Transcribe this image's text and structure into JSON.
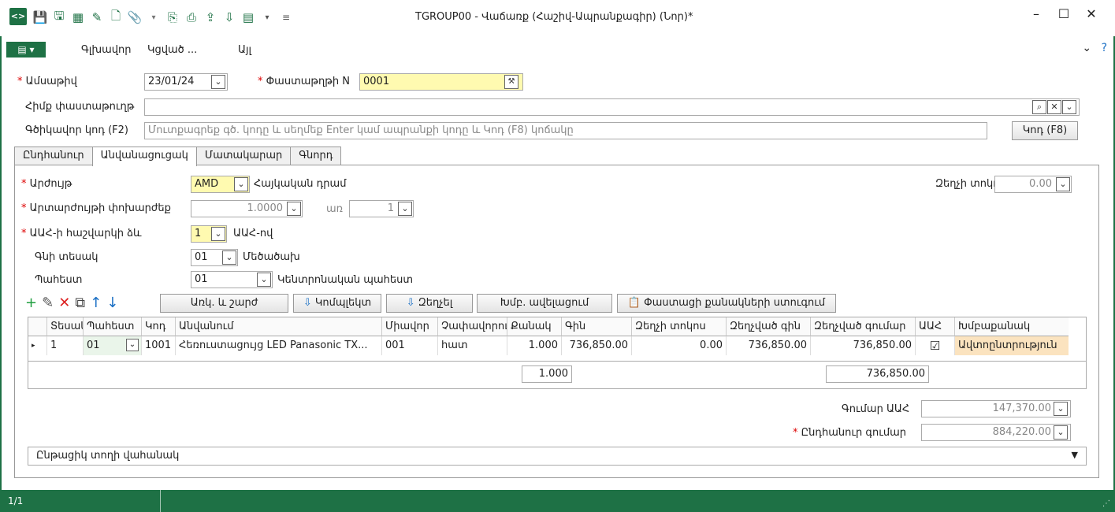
{
  "window": {
    "title": "TGROUP00 - Վաճառք (Հաշիվ-Ապրանքագիր) (Նոր)*",
    "logo": "ꟹ",
    "minimize": "–",
    "maximize": "☐",
    "close": "✕"
  },
  "qat": [
    "save-icon",
    "save-close-icon",
    "save-as-icon",
    "edit-icon",
    "new-doc-icon",
    "attach-icon",
    "dropdown-icon",
    "copy-icon",
    "print-icon",
    "export-icon",
    "import-icon",
    "table-icon",
    "more-icon"
  ],
  "menu": {
    "toggle": "▤ ▾",
    "items": [
      "Գլխավոր",
      "Կցված ...",
      "Այլ"
    ],
    "chevron": "⌄",
    "help": "?"
  },
  "form": {
    "date_label": "Ամսաթիվ",
    "date_value": "23/01/24",
    "docnum_label": "Փաստաթղթի N",
    "docnum_value": "0001",
    "basedoc_label": "Հիմք փաստաթուղթ",
    "basedoc_value": "",
    "barcode_label": "Գծիկավոր կոդ (F2)",
    "barcode_placeholder": "Մուտքագրեք գծ. կոդը և սեղմեք Enter կամ ապրանքի կոդը և Կոդ (F8) կոճակը",
    "code_button": "Կոդ (F8)"
  },
  "tabs": [
    "Ընդհանուր",
    "Անվանացուցակ",
    "Մատակարար",
    "Գնորդ"
  ],
  "panel": {
    "currency_label": "Արժույթ",
    "currency_value": "AMD",
    "currency_name": "Հայկական դրամ",
    "discount_label": "Զեղչի տոկոս",
    "discount_value": "0.00",
    "rate_label": "Արտարժույթի փոխարժեք",
    "rate_value": "1.0000",
    "per_label": "առ",
    "per_value": "1",
    "vat_label": "ԱԱՀ-ի հաշվարկի ձև",
    "vat_value": "1",
    "vat_name": "ԱԱՀ-ով",
    "price_type_label": "Գնի տեսակ",
    "price_type_value": "01",
    "price_type_name": "Մեծածախ",
    "warehouse_label": "Պահեստ",
    "warehouse_value": "01",
    "warehouse_name": "Կենտրոնական պահեստ"
  },
  "grid_toolbar": {
    "add": "+",
    "edit": "✎",
    "delete": "✕",
    "copy": "⧉",
    "up": "↑",
    "down": "↓",
    "b1": "Առկ. և շարժ",
    "b2": "Կոմպլեկտ",
    "b3": "Զեղչել",
    "b4": "Խմբ. ավելացում",
    "b5": "Փաստացի քանակների ստուգում"
  },
  "grid": {
    "headers": [
      "Տեսակ",
      "Պահեստ",
      "Կոդ",
      "Անվանում",
      "Միավոր",
      "Չափավորում",
      "Քանակ",
      "Գին",
      "Զեղչի տոկոս",
      "Զեղչված գին",
      "Զեղչված գումար",
      "ԱԱՀ",
      "Խմբաքանակ"
    ],
    "row": {
      "type": "1",
      "warehouse": "01",
      "code": "1001",
      "name": "Հեռուստացույց LED Panasonic TX...",
      "unit": "001",
      "measure": "հատ",
      "qty": "1.000",
      "price": "736,850.00",
      "discount": "0.00",
      "disc_price": "736,850.00",
      "disc_sum": "736,850.00",
      "vat": "☑",
      "batch": "Ավտոընտրություն"
    },
    "total_qty": "1.000",
    "total_sum": "736,850.00"
  },
  "totals": {
    "vat_sum_label": "Գումար ԱԱՀ",
    "vat_sum_value": "147,370.00",
    "total_label": "Ընդհանուր գումար",
    "total_value": "884,220.00"
  },
  "footer": {
    "payment_label": "Ընթացիկ տողի վահանակ"
  },
  "status": {
    "page": "1/1"
  }
}
